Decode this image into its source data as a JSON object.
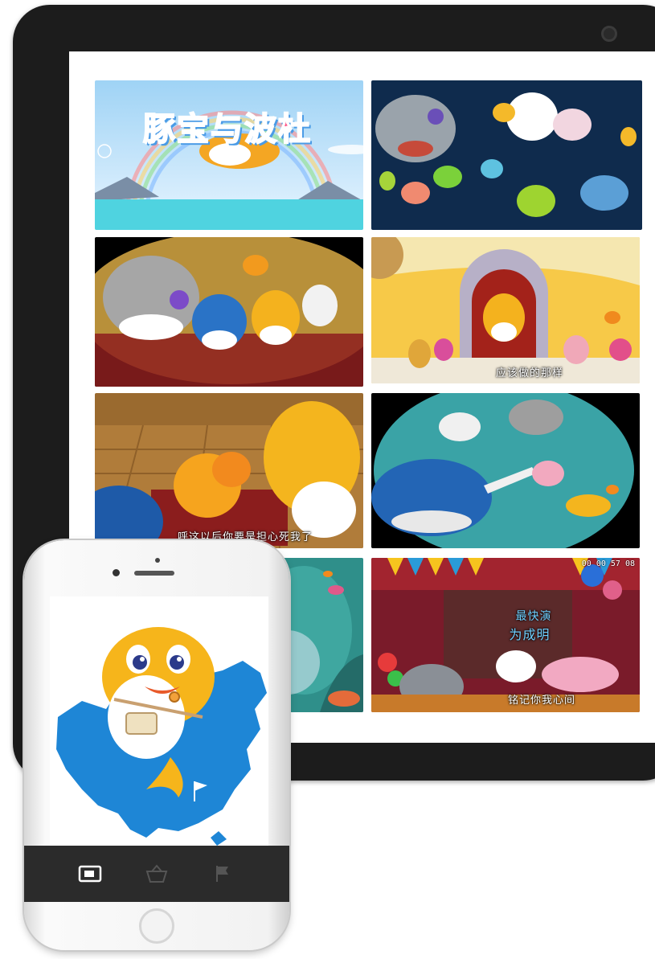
{
  "tablet": {
    "thumbnails": [
      {
        "id": "title-card",
        "title_text": "豚宝与波杜",
        "subtitle": "",
        "timecode": ""
      },
      {
        "id": "fish-crowd",
        "subtitle": "",
        "timecode": ""
      },
      {
        "id": "friends-closeup",
        "subtitle": "",
        "timecode": ""
      },
      {
        "id": "house-door",
        "subtitle": "应该做的那样",
        "timecode": ""
      },
      {
        "id": "clownfish-room",
        "subtitle": "呼这以后你要是担心死我了",
        "timecode": ""
      },
      {
        "id": "underwater-bubble",
        "subtitle": "",
        "timecode": ""
      },
      {
        "id": "coral-scene",
        "subtitle": "",
        "timecode": ""
      },
      {
        "id": "party-stage",
        "subtitle": "铭记你我心间",
        "caption_top": "最快演",
        "caption_mid": "为成明",
        "timecode": "00 00 57 08"
      }
    ]
  },
  "phone": {
    "screen_art": "mascot-on-china-map",
    "tabbar": [
      {
        "icon": "video-icon",
        "active": true
      },
      {
        "icon": "basket-icon",
        "active": false
      },
      {
        "icon": "flag-icon",
        "active": false
      }
    ]
  },
  "colors": {
    "map_blue": "#1e86d6",
    "mascot_yellow": "#f6b51b",
    "tablet_bezel": "#1c1c1c",
    "tabbar": "#2b2b2b"
  }
}
